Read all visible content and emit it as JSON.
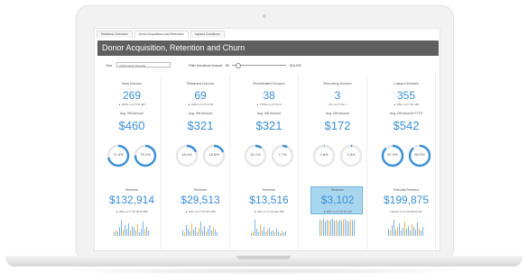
{
  "tabs": [
    "Retained Overview",
    "Donor Acquisition and Retention",
    "Lapsed Donations"
  ],
  "title": "Donor Acquisition, Retention and Churn",
  "filters": {
    "year_label": "Year",
    "year_value": "(All Donation Periods)",
    "range_label": "Filter Donations Amount",
    "range_min": "$0",
    "range_max": "$10,000"
  },
  "colors": {
    "accent": "#3a8fd6",
    "title_bar": "#5f5f5f",
    "highlight": "#a9d6ef",
    "bar_blue": "#7fb3e0",
    "bar_orange": "#f0b44c"
  },
  "cards": [
    {
      "name": "New Donors",
      "count": "269",
      "count_sub": "▲ 209% vs FYTD 365",
      "avg_label": "Avg. Gift Amount",
      "avg": "$460",
      "donut1": "71.5%",
      "donut2": "75.1%",
      "rev_label": "Revenue",
      "rev": "$132,914",
      "rev_sub": "▲ 28% vs FYTD $178,586",
      "highlight": false,
      "bars": [
        0.2,
        0.3,
        0.25,
        0.5,
        0.9,
        0.35,
        0.6,
        0.4,
        0.7,
        0.3,
        0.55,
        0.45,
        0.3,
        0.65,
        0.2,
        0.4,
        0.8,
        0.35,
        0.5,
        0.3
      ]
    },
    {
      "name": "Retained Donors",
      "count": "69",
      "count_sub": "▲ 208% vs FYTD 30",
      "avg_label": "Avg. Gift Amount",
      "avg": "$321",
      "donut1": "18.4%",
      "donut2": "18.8%",
      "rev_label": "Revenue",
      "rev": "$29,513",
      "rev_sub": "▲ 16% vs FYTD $44,382",
      "highlight": false,
      "bars": [
        0.3,
        0.2,
        0.6,
        0.4,
        0.25,
        0.7,
        0.35,
        0.5,
        0.2,
        0.45,
        0.8,
        0.3,
        0.55,
        0.25,
        0.4,
        0.6,
        0.3,
        0.5,
        0.35,
        0.2
      ]
    },
    {
      "name": "Reactivated Donors",
      "count": "38",
      "count_sub": "▲ 1785% vs FYTD 2",
      "avg_label": "Avg. Gift Amount",
      "avg": "$321",
      "donut1": "10.1%",
      "donut2": "7.7%",
      "rev_label": "Revenue",
      "rev": "$13,516",
      "rev_sub": "▲ 39% vs FYTD $11,063",
      "highlight": false,
      "bars": [
        0.15,
        0.25,
        0.9,
        0.4,
        0.2,
        0.6,
        0.3,
        0.5,
        0.2,
        0.35,
        0.45,
        0.25,
        0.3,
        0.2,
        0.4,
        0.25,
        0.15,
        0.3,
        0.2,
        0.25
      ]
    },
    {
      "name": "Recurring Donors",
      "count": "3",
      "count_sub": "0% vs FYTD 3",
      "avg_label": "Avg. Gift Amount",
      "avg": "$172",
      "donut1": "0.8%",
      "donut2": "1.8%",
      "rev_label": "Revenue",
      "rev": "$3,102",
      "rev_sub": "▲ 38% vs FYTD $2,246",
      "highlight": true,
      "bars": [
        0.9,
        0.85,
        0.95,
        0.8,
        0.9,
        0.85,
        0.9,
        0.95,
        0.85,
        0.9,
        0.8,
        0.9,
        0.85,
        0.9,
        0.95,
        0.85,
        0.8,
        0.9,
        0.85,
        0.9
      ]
    },
    {
      "name": "Lapsed Donors",
      "count": "355",
      "count_sub": "▲ 25% vs FYTD 284",
      "avg_label": "Avg. Gift Amount FYTD",
      "avg": "$542",
      "donut1": "87.9%",
      "donut2": "88.5%",
      "rev_label": "Potential Revenue",
      "rev": "$199,875",
      "rev_sub": "Lapsed vs FYTD $156,421",
      "highlight": false,
      "bars": [
        0.4,
        0.3,
        0.6,
        0.9,
        0.35,
        0.5,
        0.7,
        0.3,
        0.45,
        0.8,
        0.4,
        0.55,
        0.3,
        0.65,
        0.5,
        0.35,
        0.75,
        0.4,
        0.3,
        0.5
      ]
    }
  ]
}
